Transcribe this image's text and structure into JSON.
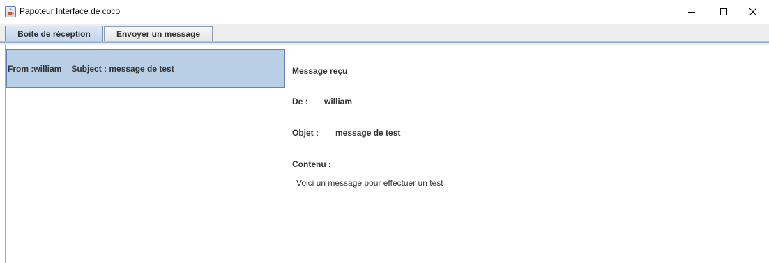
{
  "window": {
    "title": "Papoteur Interface de coco",
    "icons": {
      "app": "java-cup-icon",
      "minimize": "minimize-icon",
      "maximize": "maximize-icon",
      "close": "close-icon"
    }
  },
  "tabs": [
    {
      "label": "Boite de réception",
      "selected": true
    },
    {
      "label": "Envoyer un message",
      "selected": false
    }
  ],
  "inbox": {
    "items": [
      {
        "from_label": "From :william",
        "subject_label": "Subject : message de test"
      }
    ]
  },
  "message": {
    "heading": "Message reçu",
    "from_label": "De :",
    "from_value": "william",
    "subject_label": "Objet :",
    "subject_value": "message de test",
    "content_label": "Contenu :",
    "content_value": "Voici un message pour effectuer un test"
  },
  "colors": {
    "selected_item_bg": "#b8cfe5",
    "selected_item_border": "#6382bf",
    "tab_selected_bg": "#c3d5ee"
  }
}
